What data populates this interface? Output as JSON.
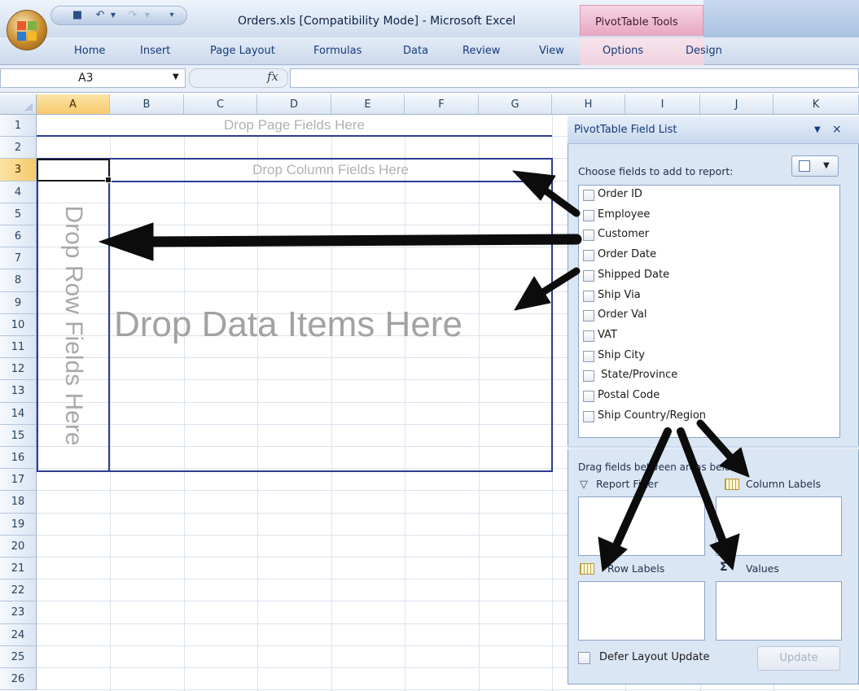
{
  "window": {
    "title": "Orders.xls  [Compatibility Mode]  -  Microsoft Excel",
    "context_group": "PivotTable Tools"
  },
  "ribbon": {
    "tabs": [
      "Home",
      "Insert",
      "Page Layout",
      "Formulas",
      "Data",
      "Review",
      "View"
    ],
    "context_tabs": [
      "Options",
      "Design"
    ]
  },
  "formula_bar": {
    "name_box": "A3",
    "fx_label": "fx",
    "formula": ""
  },
  "sheet": {
    "columns": [
      "A",
      "B",
      "C",
      "D",
      "E",
      "F",
      "G",
      "H",
      "I",
      "J",
      "K"
    ],
    "active_column": "A",
    "rows": [
      "1",
      "2",
      "3",
      "4",
      "5",
      "6",
      "7",
      "8",
      "9",
      "10",
      "11",
      "12",
      "13",
      "14",
      "15",
      "16",
      "17",
      "18",
      "19",
      "20",
      "21",
      "22",
      "23",
      "24",
      "25",
      "26"
    ],
    "active_row": "3"
  },
  "pivot": {
    "page_fields": "Drop Page Fields Here",
    "column_fields": "Drop Column Fields Here",
    "row_fields": "Drop Row Fields Here",
    "data_items": "Drop Data Items Here"
  },
  "field_list": {
    "title": "PivotTable Field List",
    "choose_label": "Choose fields to add to report:",
    "fields": [
      "Order ID",
      "Employee",
      "Customer",
      "Order Date",
      "Shipped Date",
      "Ship Via",
      "Order Val",
      "VAT",
      "Ship City",
      " State/Province",
      "Postal Code",
      "Ship Country/Region"
    ],
    "drag_label": "Drag fields between areas below:",
    "areas": {
      "report_filter": "Report Filter",
      "column_labels": "Column Labels",
      "row_labels": "Row Labels",
      "values": "Values"
    },
    "defer_label": "Defer Layout Update",
    "update_label": "Update"
  }
}
